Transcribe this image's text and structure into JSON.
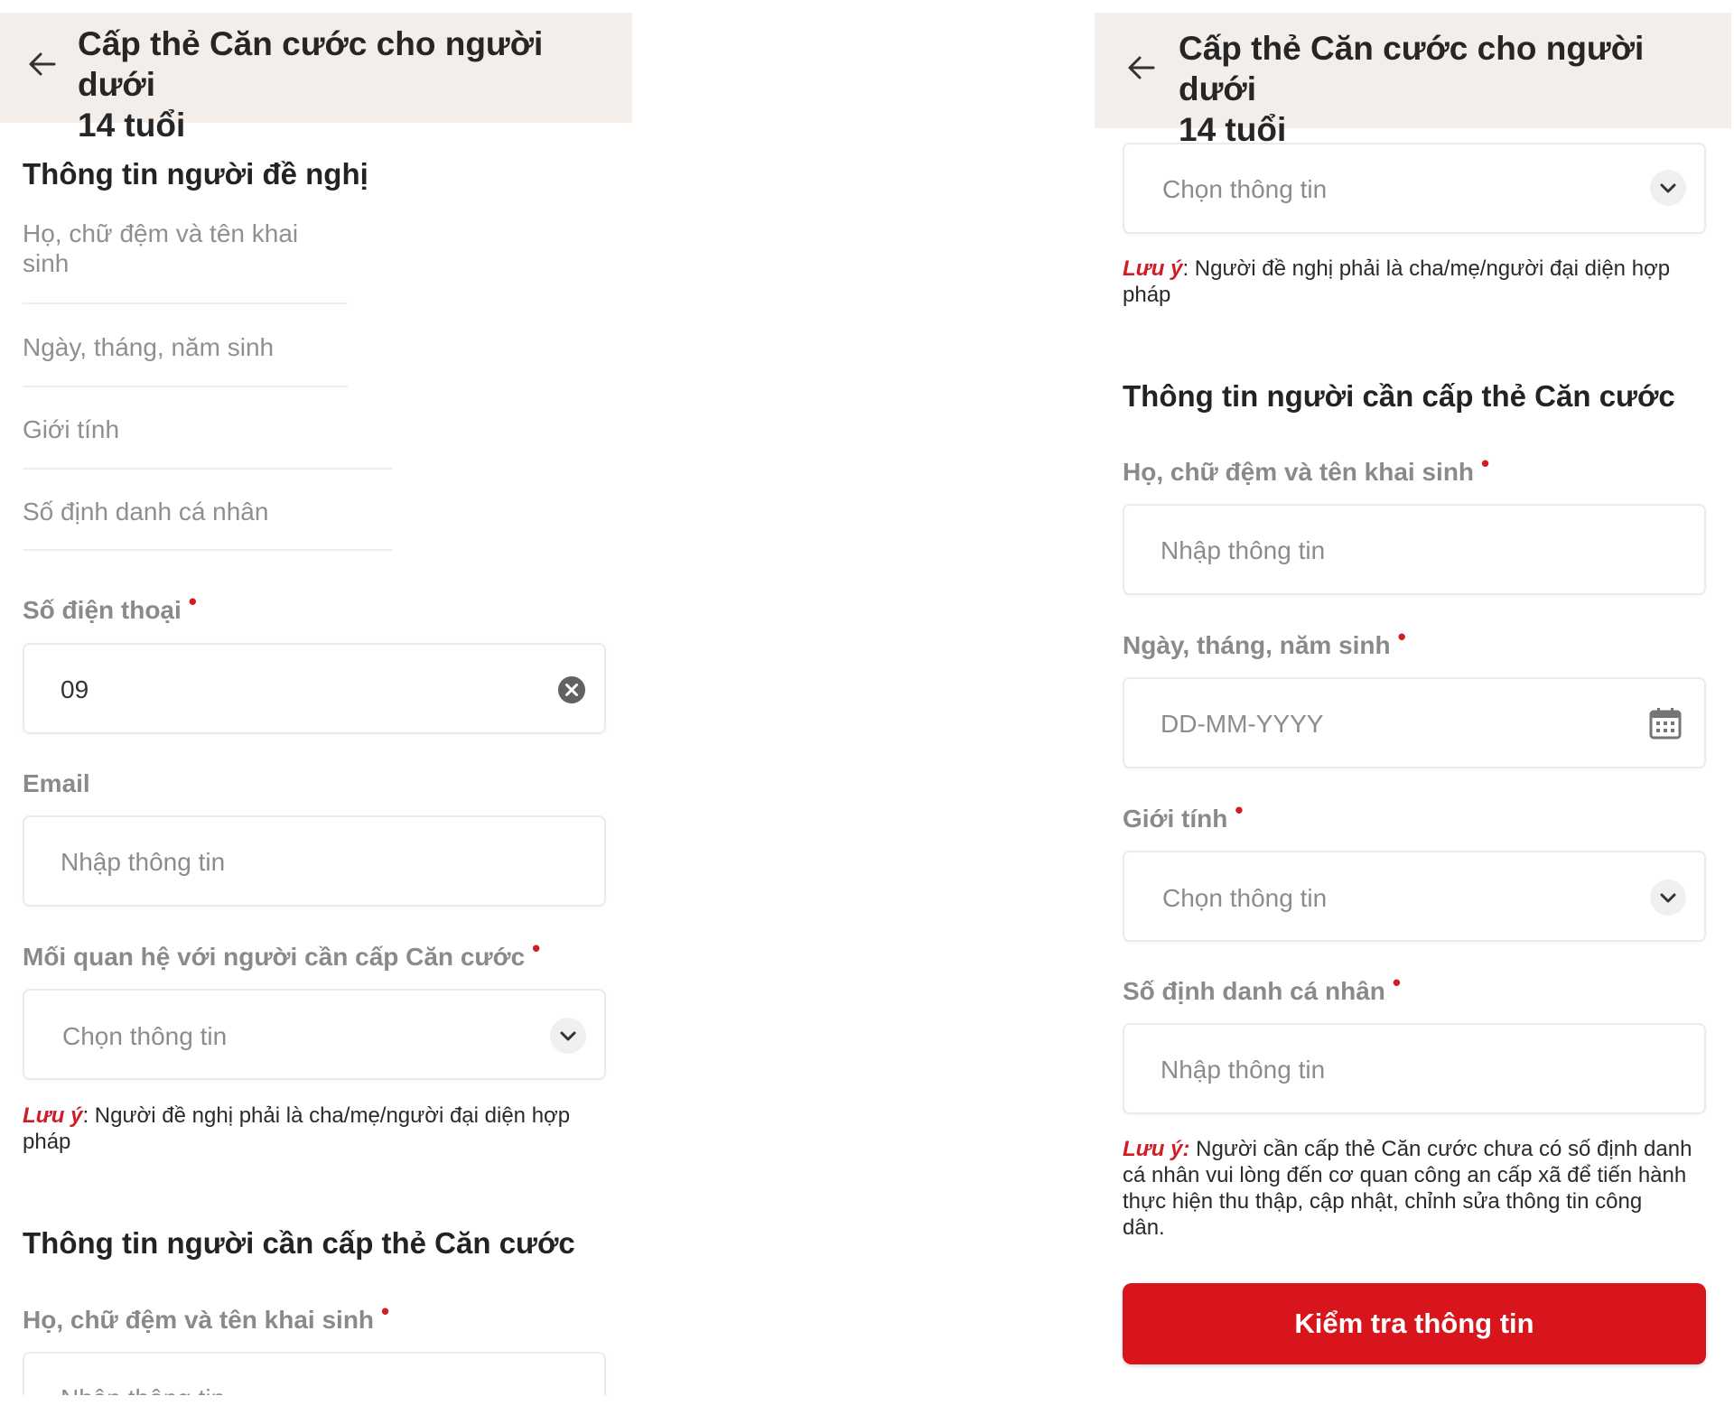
{
  "header": {
    "title_line1": "Cấp thẻ Căn cước cho người dưới",
    "title_line2": "14 tuổi"
  },
  "left": {
    "proposer_section_title": "Thông tin người đề nghị",
    "static_fields": [
      {
        "label_line1": "Họ, chữ đệm và tên khai",
        "label_line2": "sinh"
      },
      {
        "label_line1": "Ngày, tháng, năm sinh"
      },
      {
        "label_line1": "Giới tính"
      },
      {
        "label_line1": "Số định danh cá nhân"
      }
    ],
    "phone": {
      "label": "Số điện thoại",
      "required_mark": "•",
      "value": "09"
    },
    "email": {
      "label": "Email",
      "placeholder": "Nhập thông tin"
    },
    "relationship": {
      "label": "Mối quan hệ với người cần cấp Căn cước",
      "required_mark": "•",
      "placeholder": "Chọn thông tin"
    },
    "note": {
      "label": "Lưu ý",
      "text_line1": ": Người đề nghị phải là cha/mẹ/người đại diện hợp",
      "text_line2": "pháp"
    },
    "applicant_section_title": "Thông tin người cần cấp thẻ Căn cước",
    "applicant_name": {
      "label": "Họ, chữ đệm và tên khai sinh",
      "required_mark": "•",
      "placeholder": "Nhập thông tin"
    }
  },
  "right": {
    "top_select": {
      "placeholder": "Chọn thông tin"
    },
    "note1": {
      "label": "Lưu ý",
      "text_line1": ": Người đề nghị phải là cha/mẹ/người đại diện hợp",
      "text_line2": "pháp"
    },
    "applicant_section_title": "Thông tin người cần cấp thẻ Căn cước",
    "name": {
      "label": "Họ, chữ đệm và tên khai sinh",
      "required_mark": "•",
      "placeholder": "Nhập thông tin"
    },
    "dob": {
      "label": "Ngày, tháng, năm sinh",
      "required_mark": "•",
      "placeholder": "DD-MM-YYYY"
    },
    "gender": {
      "label": "Giới tính",
      "required_mark": "•",
      "placeholder": "Chọn thông tin"
    },
    "id_number": {
      "label": "Số định danh cá nhân",
      "required_mark": "•",
      "placeholder": "Nhập thông tin"
    },
    "note2": {
      "label": "Lưu ý:",
      "line1": " Người cần cấp thẻ Căn cước chưa có số định danh",
      "line2": "cá nhân vui lòng đến cơ quan công an cấp xã để tiến hành",
      "line3": "thực hiện thu thập, cập nhật, chỉnh sửa thông tin công",
      "line4": "dân."
    },
    "submit_label": "Kiểm tra thông tin"
  },
  "colors": {
    "accent_red": "#d8151c",
    "header_bg": "#f3eeea"
  },
  "icons": [
    "back-arrow-icon",
    "clear-icon",
    "chevron-down-icon",
    "calendar-icon"
  ]
}
